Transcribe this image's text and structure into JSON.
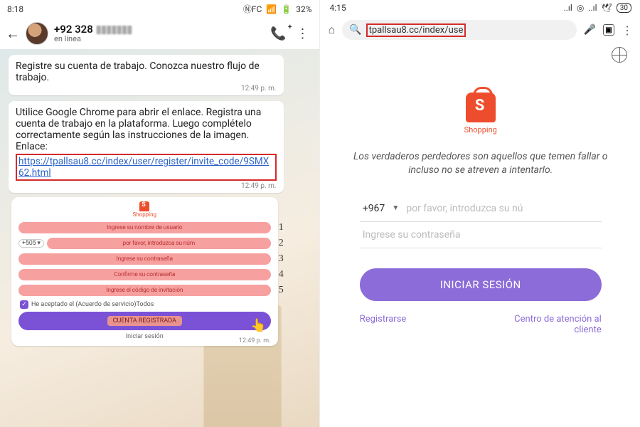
{
  "left": {
    "status": {
      "time": "8:18",
      "signal": "📶",
      "battery": "32%"
    },
    "header": {
      "phone_prefix": "+92 328",
      "phone_blur": "▮▮▮▮▮▮▮",
      "subtitle": "en línea"
    },
    "msg1": {
      "text": "Registre su cuenta de trabajo. Conozca nuestro flujo de trabajo.",
      "time": "12:49 p. m."
    },
    "msg2": {
      "text": "Utilice Google Chrome para abrir el enlace. Registra una cuenta de trabajo en la plataforma. Luego complételo correctamente según las instrucciones de la imagen. Enlace:",
      "link": "https://tpallsau8.cc/index/user/register/invite_code/9SMX62.html",
      "time": "12:49 p. m."
    },
    "form": {
      "brand": "Shopping",
      "f1": "Ingrese su nombre de usuario",
      "code": "+505 ▾",
      "f2": "por favor, introduzca su núm",
      "f3": "Ingrese su contraseña",
      "f4": "Confirme su contraseña",
      "f5": "Ingrese el código de invitación",
      "agree": "He aceptado el (Acuerdo de servicio)Todos",
      "btn": "CUENTA REGISTRADA",
      "login": "Iniciar sesión",
      "time": "12:49 p. m."
    }
  },
  "right": {
    "status": {
      "time": "4:15",
      "battery": "30"
    },
    "url": "tpallsau8.cc/index/use",
    "brand": "Shopping",
    "quote": "Los verdaderos perdedores son aquellos que temen fallar o incluso no se atreven a intentarlo.",
    "phone_code": "+967",
    "ph_phone": "por favor, introduzca su nú",
    "ph_pass": "Ingrese su contraseña",
    "login_btn": "INICIAR SESIÓN",
    "link_register": "Registrarse",
    "link_support": "Centro de atención al cliente"
  }
}
